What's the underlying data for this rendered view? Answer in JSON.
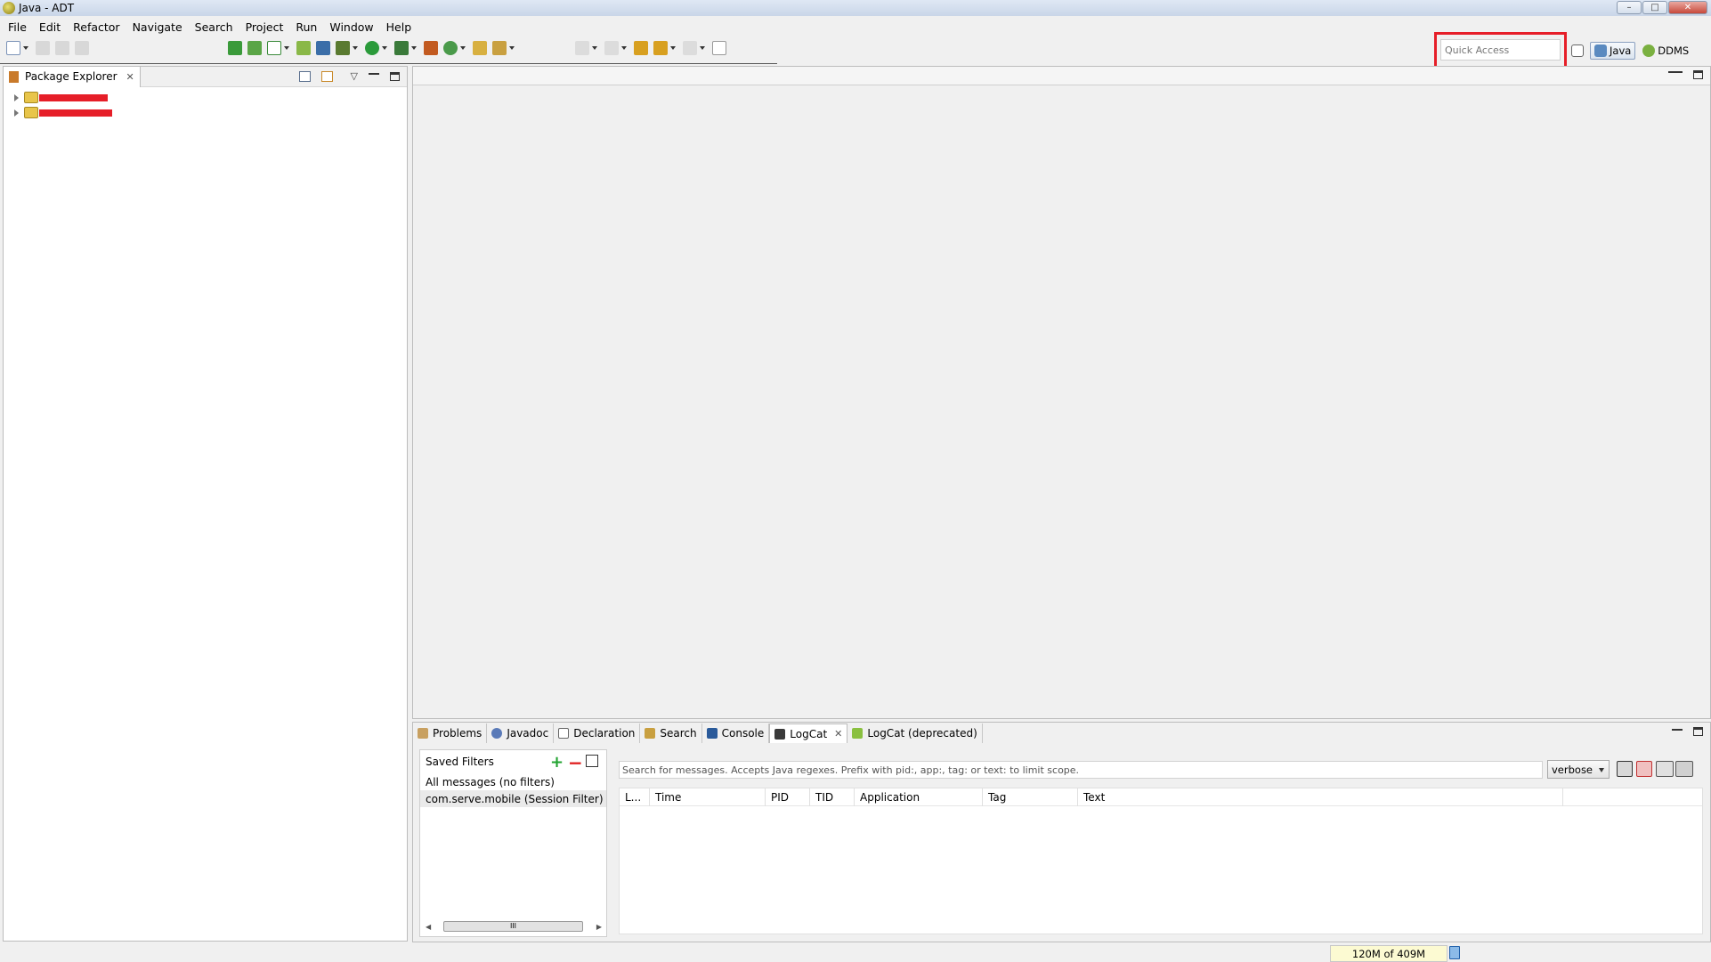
{
  "window": {
    "title": "Java - ADT",
    "minimize": "–",
    "maximize": "□",
    "close": "✕"
  },
  "menu": [
    "File",
    "Edit",
    "Refactor",
    "Navigate",
    "Search",
    "Project",
    "Run",
    "Window",
    "Help"
  ],
  "toolbar": {
    "quick_access_placeholder": "Quick Access",
    "perspectives": [
      "Java",
      "DDMS"
    ],
    "active_perspective": "Java"
  },
  "package_explorer": {
    "tab_label": "Package Explorer",
    "projects_redacted": true
  },
  "bottom_panel": {
    "tabs": [
      {
        "label": "Problems",
        "icon": "problems-icon"
      },
      {
        "label": "Javadoc",
        "icon": "javadoc-icon"
      },
      {
        "label": "Declaration",
        "icon": "declaration-icon"
      },
      {
        "label": "Search",
        "icon": "search-icon"
      },
      {
        "label": "Console",
        "icon": "console-icon"
      },
      {
        "label": "LogCat",
        "icon": "logcat-icon"
      },
      {
        "label": "LogCat (deprecated)",
        "icon": "android-icon"
      }
    ],
    "active_tab": "LogCat",
    "saved_filters": {
      "title": "Saved Filters",
      "items": [
        "All messages (no filters)",
        "com.serve.mobile (Session Filter)"
      ],
      "selected": 1,
      "scroll_thumb": "III"
    },
    "logcat": {
      "search_placeholder": "Search for messages. Accepts Java regexes. Prefix with pid:, app:, tag: or text: to limit scope.",
      "level": "verbose",
      "columns": [
        "L...",
        "Time",
        "PID",
        "TID",
        "Application",
        "Tag",
        "Text"
      ]
    }
  },
  "status": {
    "heap": "120M of 409M"
  },
  "colors": {
    "highlight_red": "#e61e28",
    "heap_bg": "#fcfad2"
  }
}
